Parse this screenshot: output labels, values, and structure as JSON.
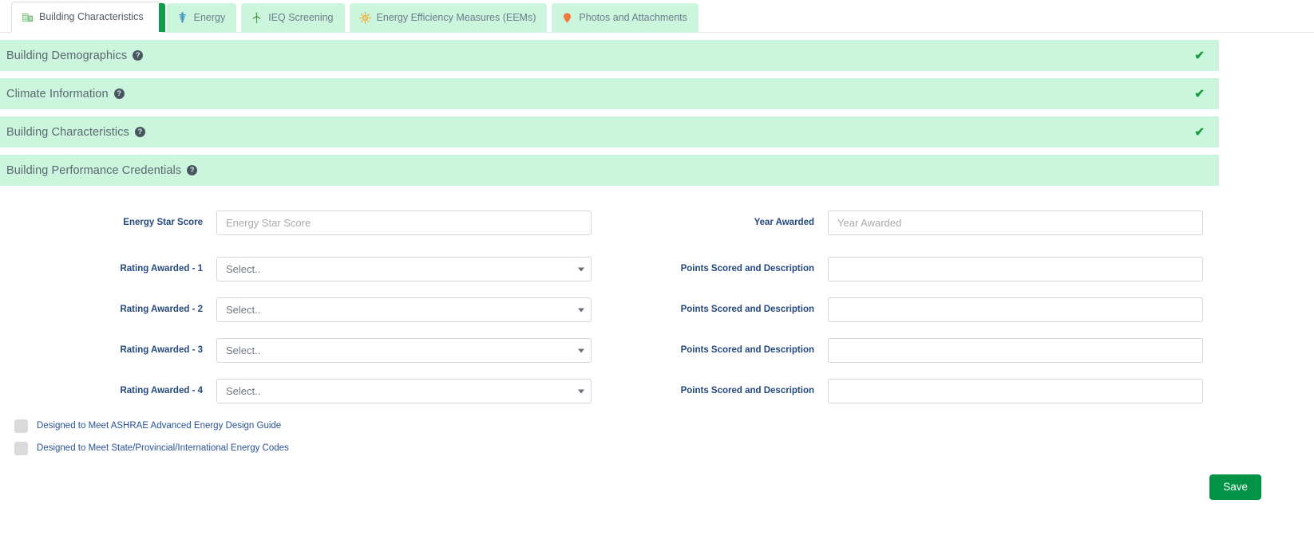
{
  "tabs": [
    {
      "label": "Building Characteristics",
      "icon": "building-icon",
      "active": true
    },
    {
      "label": "Energy",
      "icon": "energy-tower-icon",
      "active": false
    },
    {
      "label": "IEQ Screening",
      "icon": "wind-turbine-icon",
      "active": false
    },
    {
      "label": "Energy Efficiency Measures (EEMs)",
      "icon": "sun-icon",
      "active": false
    },
    {
      "label": "Photos and Attachments",
      "icon": "map-pin-icon",
      "active": false
    }
  ],
  "sections": [
    {
      "title": "Building Demographics",
      "help": "?",
      "completed": true,
      "check": "✔"
    },
    {
      "title": "Climate Information",
      "help": "?",
      "completed": true,
      "check": "✔"
    },
    {
      "title": "Building Characteristics",
      "help": "?",
      "completed": true,
      "check": "✔"
    },
    {
      "title": "Building Performance Credentials",
      "help": "?",
      "completed": false,
      "check": ""
    }
  ],
  "form": {
    "energy_star_score": {
      "label": "Energy Star Score",
      "placeholder": "Energy Star Score",
      "value": ""
    },
    "year_awarded": {
      "label": "Year Awarded",
      "placeholder": "Year Awarded",
      "value": ""
    },
    "select_placeholder": "Select..",
    "rows": [
      {
        "rating_label": "Rating Awarded - 1",
        "rating_value": "Select..",
        "points_label": "Points Scored and Description",
        "points_value": "",
        "points_placeholder": ""
      },
      {
        "rating_label": "Rating Awarded - 2",
        "rating_value": "Select..",
        "points_label": "Points Scored and Description",
        "points_value": "",
        "points_placeholder": ""
      },
      {
        "rating_label": "Rating Awarded - 3",
        "rating_value": "Select..",
        "points_label": "Points Scored and Description",
        "points_value": "",
        "points_placeholder": ""
      },
      {
        "rating_label": "Rating Awarded - 4",
        "rating_value": "Select..",
        "points_label": "Points Scored and Description",
        "points_value": "",
        "points_placeholder": ""
      }
    ],
    "checkboxes": [
      {
        "label": "Designed to Meet ASHRAE Advanced Energy Design Guide",
        "checked": false
      },
      {
        "label": "Designed to Meet State/Provincial/International Energy Codes",
        "checked": false
      }
    ]
  },
  "actions": {
    "save_label": "Save"
  },
  "colors": {
    "accent_green": "#009245",
    "section_bg": "#ccf5de",
    "tab_bg": "#ccf5de",
    "active_tab_edge": "#0e9c4d",
    "label_blue": "#24487e",
    "link_blue": "#2a5296",
    "check_green": "#179c3c"
  }
}
